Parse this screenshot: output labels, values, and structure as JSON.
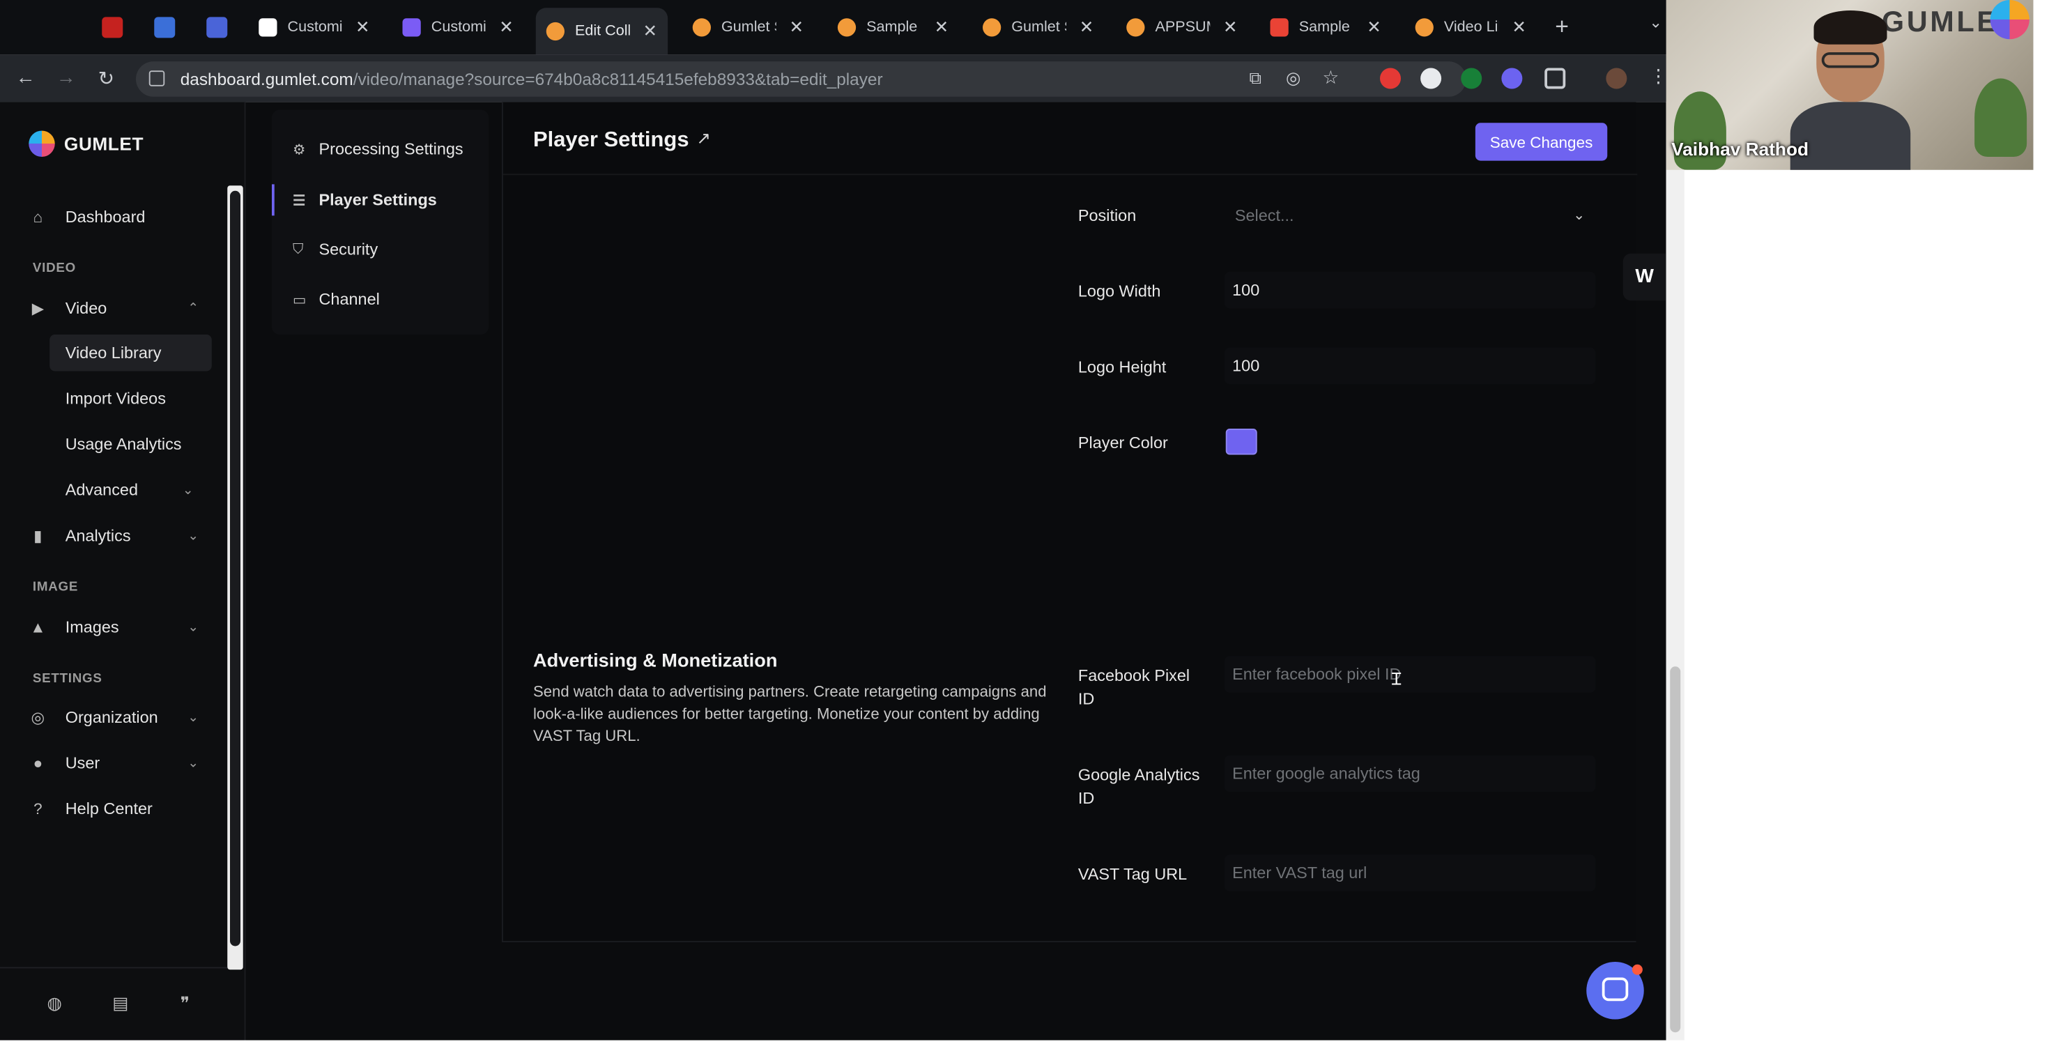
{
  "browser": {
    "tabs": [
      {
        "title": "Customiz",
        "favicon_color": "#ffffff"
      },
      {
        "title": "Customiz",
        "favicon_color": "#7b5cf5"
      },
      {
        "title": "Edit Colle",
        "favicon_color": "#f29b3a"
      },
      {
        "title": "Gumlet S",
        "favicon_color": "#f29b3a"
      },
      {
        "title": "Sample V",
        "favicon_color": "#f29b3a"
      },
      {
        "title": "Gumlet S",
        "favicon_color": "#f29b3a"
      },
      {
        "title": "APPSUMO",
        "favicon_color": "#f29b3a"
      },
      {
        "title": "Sample e",
        "favicon_color": "#ea4335"
      },
      {
        "title": "Video Lib",
        "favicon_color": "#f29b3a"
      }
    ],
    "url_host": "dashboard.gumlet.com",
    "url_path": "/video/manage?source=674b0a8c81145415efeb8933&tab=edit_player"
  },
  "sidebar": {
    "brand": "GUMLET",
    "dashboard": "Dashboard",
    "section_video": "VIDEO",
    "video": "Video",
    "video_library": "Video Library",
    "import_videos": "Import Videos",
    "usage_analytics": "Usage Analytics",
    "advanced": "Advanced",
    "analytics": "Analytics",
    "section_image": "IMAGE",
    "images": "Images",
    "section_settings": "SETTINGS",
    "organization": "Organization",
    "user": "User",
    "help_center": "Help Center"
  },
  "settings_nav": {
    "processing": "Processing Settings",
    "player": "Player Settings",
    "security": "Security",
    "channel": "Channel"
  },
  "header": {
    "title": "Player Settings",
    "save_label": "Save Changes"
  },
  "player_fields": {
    "position_label": "Position",
    "position_placeholder": "Select...",
    "logo_width_label": "Logo Width",
    "logo_width_value": "100",
    "logo_height_label": "Logo Height",
    "logo_height_value": "100",
    "player_color_label": "Player Color",
    "player_color": "#6f63f0"
  },
  "advertising": {
    "title": "Advertising & Monetization",
    "description": "Send watch data to advertising partners. Create retargeting campaigns and look-a-like audiences for better targeting. Monetize your content by adding VAST Tag URL.",
    "facebook_label": "Facebook Pixel ID",
    "facebook_placeholder": "Enter facebook pixel ID",
    "google_label": "Google Analytics ID",
    "google_placeholder": "Enter google analytics tag",
    "vast_label": "VAST Tag URL",
    "vast_placeholder": "Enter VAST tag url"
  },
  "video_call": {
    "participant": "Vaibhav Rathod",
    "background_text": "GUMLET"
  },
  "colors": {
    "accent": "#6f63f0",
    "background": "#0b0c0e"
  }
}
